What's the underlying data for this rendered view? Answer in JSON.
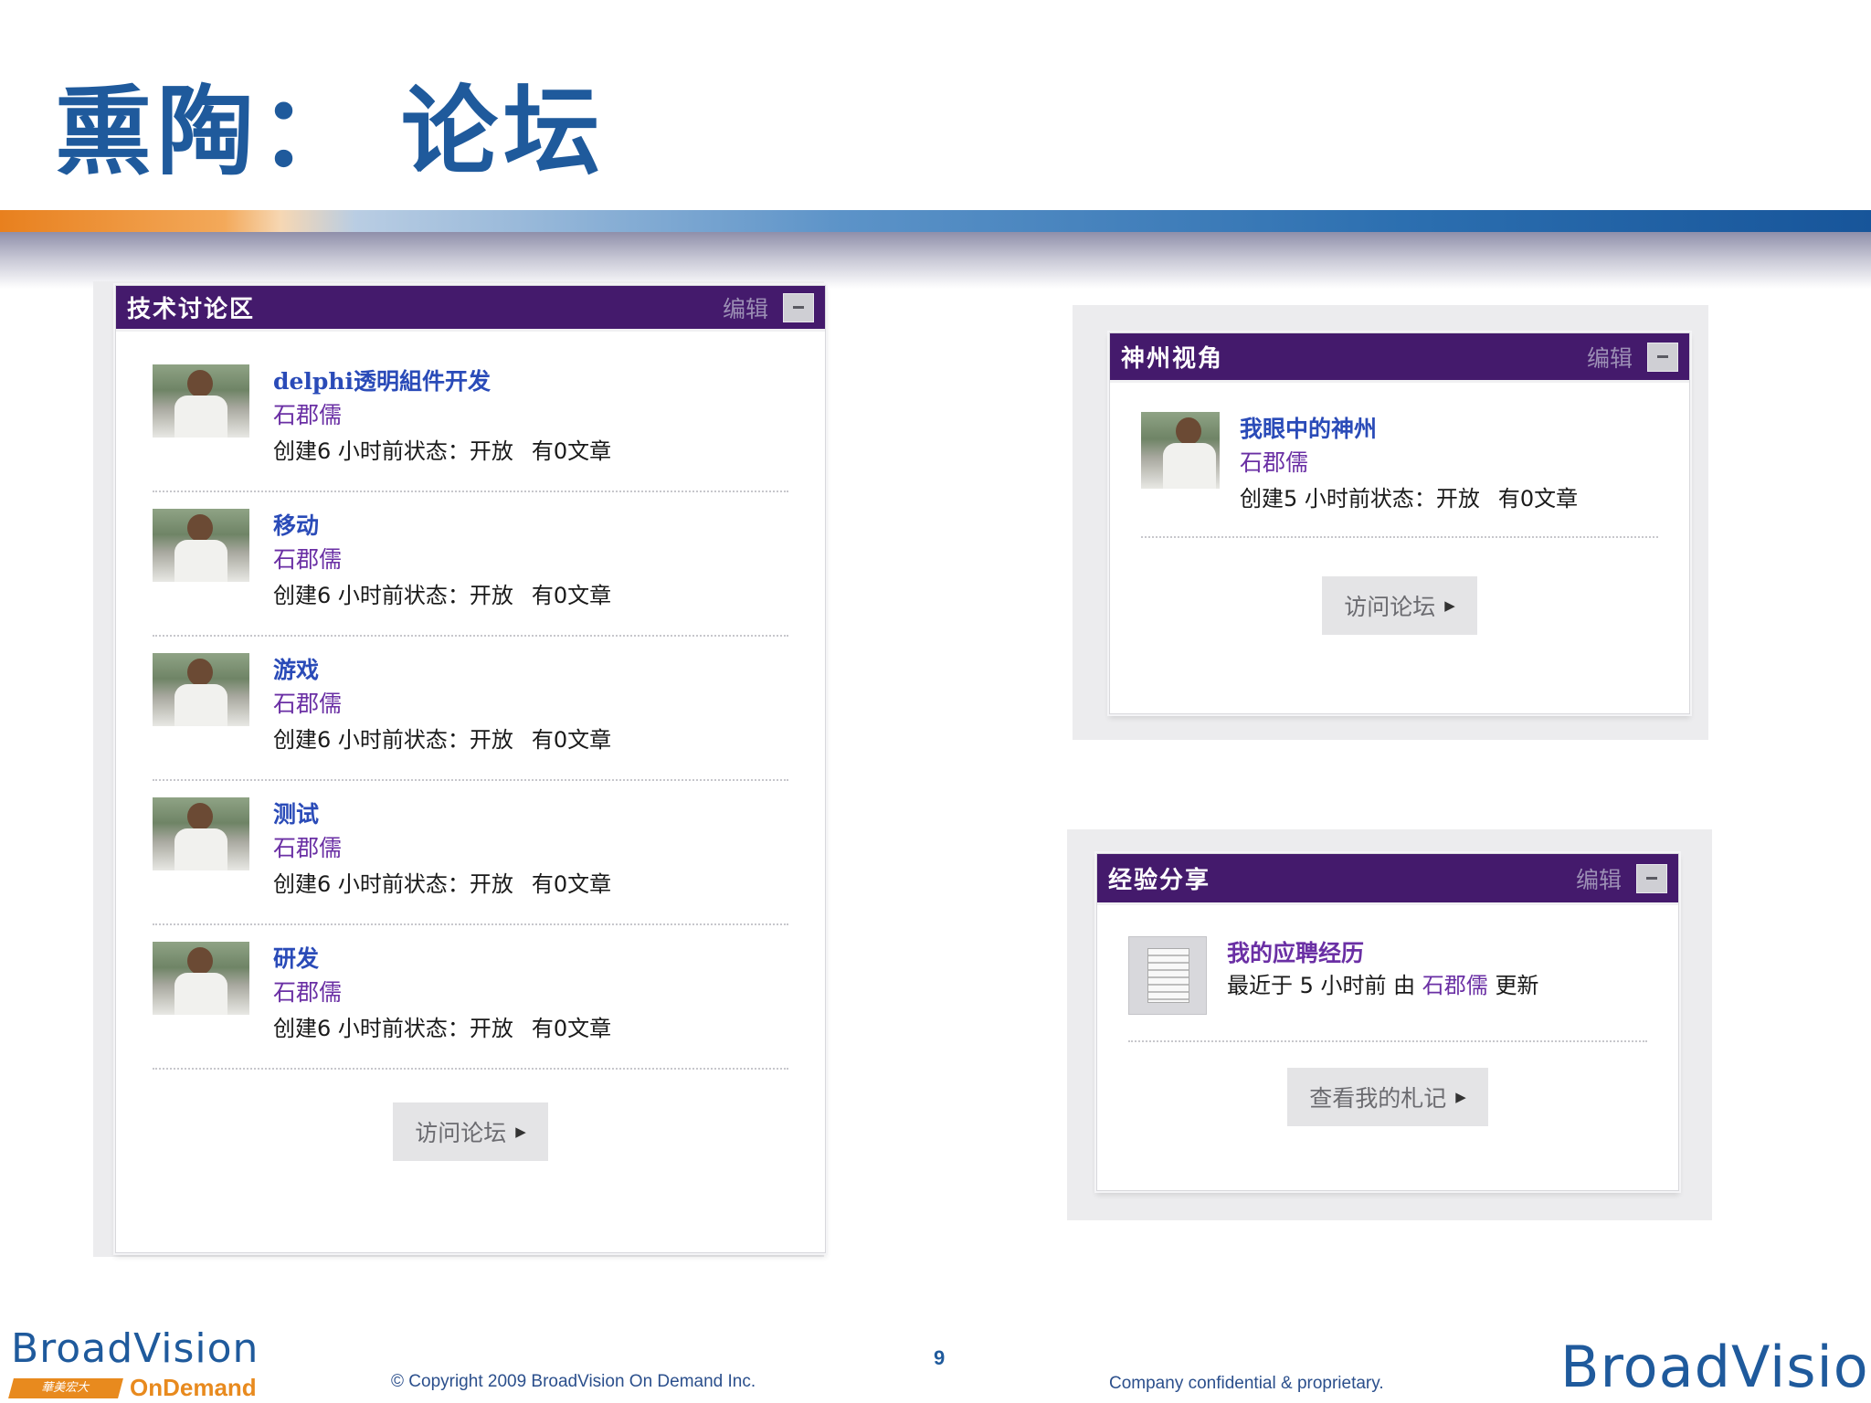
{
  "slide": {
    "title": "熏陶：  论坛",
    "page_number": "9",
    "copyright": "© Copyright 2009 BroadVision On Demand Inc.",
    "confidential": "Company confidential & proprietary.",
    "logo_small": "BroadVision",
    "logo_small_cn": "華美宏大",
    "logo_small_sub": "OnDemand",
    "logo_big": "BroadVision"
  },
  "colors": {
    "widget_header": "#441a6c",
    "title_blue": "#1f5a9c",
    "link_blue": "#2a4bb8",
    "author_purple": "#6a2fa4",
    "accent_orange": "#e88a1e"
  },
  "tech_forum": {
    "title": "技术讨论区",
    "edit": "编辑",
    "topics": [
      {
        "title": "delphi透明組件开发",
        "author": "石郡儒",
        "status": "创建6 小时前状态：开放",
        "articles": "有0文章"
      },
      {
        "title": "移动",
        "author": "石郡儒",
        "status": "创建6 小时前状态：开放",
        "articles": "有0文章"
      },
      {
        "title": "游戏",
        "author": "石郡儒",
        "status": "创建6 小时前状态：开放",
        "articles": "有0文章"
      },
      {
        "title": "测试",
        "author": "石郡儒",
        "status": "创建6 小时前状态：开放",
        "articles": "有0文章"
      },
      {
        "title": "研发",
        "author": "石郡儒",
        "status": "创建6 小时前状态：开放",
        "articles": "有0文章"
      }
    ],
    "visit_button": "访问论坛"
  },
  "shenzhou": {
    "title": "神州视角",
    "edit": "编辑",
    "topic": {
      "title": "我眼中的神州",
      "author": "石郡儒",
      "status": "创建5 小时前状态：开放",
      "articles": "有0文章"
    },
    "visit_button": "访问论坛"
  },
  "experience": {
    "title": "经验分享",
    "edit": "编辑",
    "entry": {
      "title": "我的应聘经历",
      "prefix": "最近于 5 小时前 由",
      "author": "石郡儒",
      "suffix": "更新"
    },
    "view_button": "查看我的札记"
  }
}
